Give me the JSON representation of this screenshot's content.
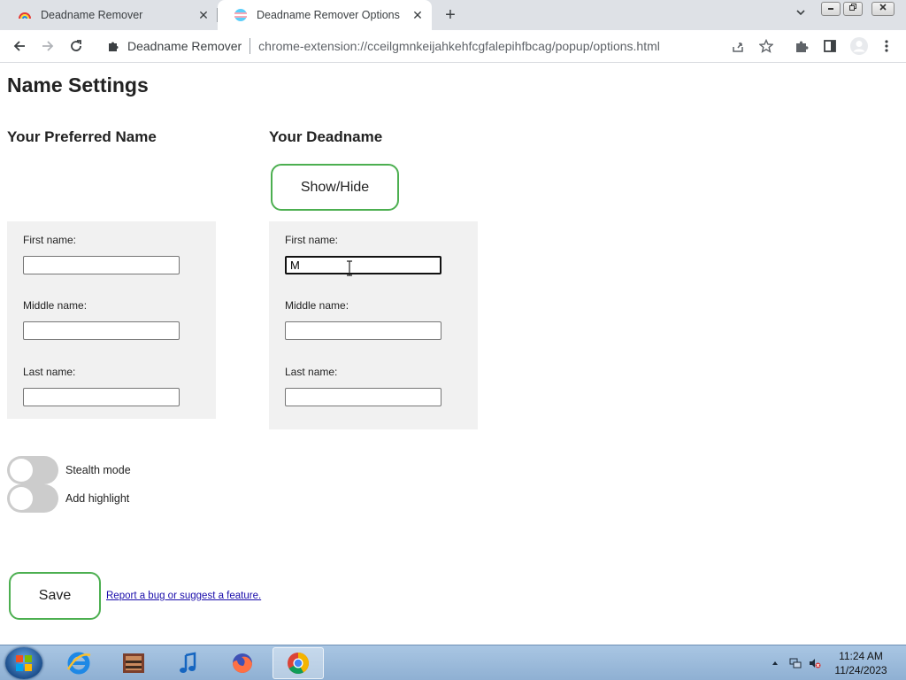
{
  "browser": {
    "tabs": [
      {
        "title": "Deadname Remover",
        "active": false
      },
      {
        "title": "Deadname Remover Options",
        "active": true
      }
    ],
    "new_tab_symbol": "+",
    "close_symbol": "✕",
    "omnibox": {
      "site_name": "Deadname Remover",
      "url": "chrome-extension://cceilgmnkeijahkehfcgfalepihfbcag/popup/options.html"
    }
  },
  "page": {
    "title": "Name Settings",
    "preferred": {
      "heading": "Your Preferred Name",
      "first_label": "First name:",
      "first_value": "",
      "middle_label": "Middle name:",
      "middle_value": "",
      "last_label": "Last name:",
      "last_value": ""
    },
    "deadname": {
      "heading": "Your Deadname",
      "show_hide_label": "Show/Hide",
      "first_label": "First name:",
      "first_value": "M",
      "middle_label": "Middle name:",
      "middle_value": "",
      "last_label": "Last name:",
      "last_value": ""
    },
    "toggles": {
      "stealth_label": "Stealth mode",
      "stealth_on": false,
      "highlight_label": "Add highlight",
      "highlight_on": false
    },
    "save_label": "Save",
    "report_link": "Report a bug or suggest a feature."
  },
  "taskbar": {
    "time": "11:24 AM",
    "date": "11/24/2023",
    "apps": [
      "internet-explorer",
      "media-center",
      "itunes",
      "firefox",
      "chrome"
    ]
  },
  "colors": {
    "accent_green": "#4caf50",
    "panel_bg": "#f1f1f1",
    "toggle_off": "#cccccc",
    "link": "#1a0dab"
  }
}
